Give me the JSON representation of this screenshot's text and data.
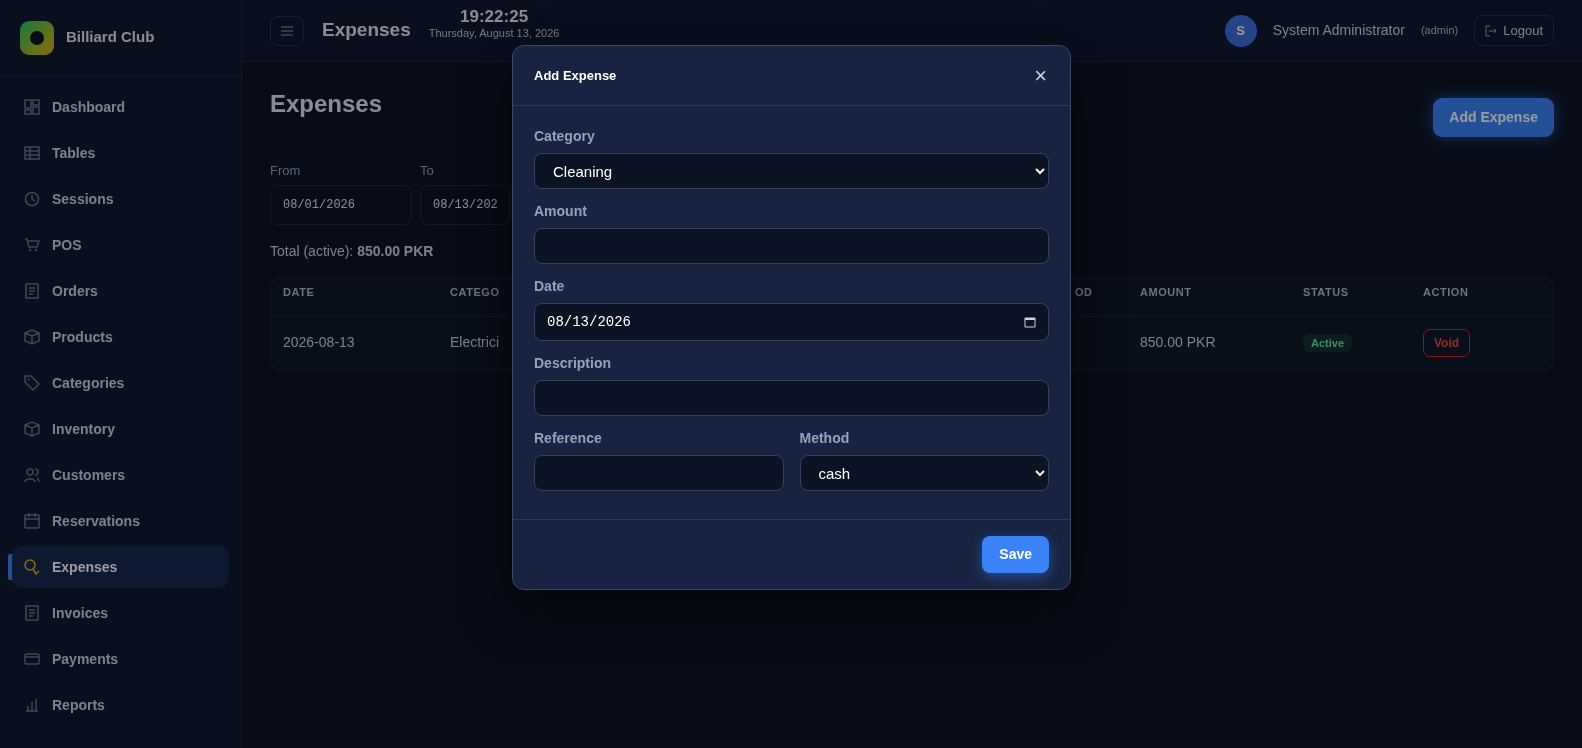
{
  "sidebar": {
    "brand": "Billiard Club",
    "items": [
      {
        "label": "Dashboard",
        "selected": false
      },
      {
        "label": "Tables",
        "selected": false
      },
      {
        "label": "Sessions",
        "selected": false
      },
      {
        "label": "POS",
        "selected": false
      },
      {
        "label": "Orders",
        "selected": false
      },
      {
        "label": "Products",
        "selected": false
      },
      {
        "label": "Categories",
        "selected": false
      },
      {
        "label": "Inventory",
        "selected": false
      },
      {
        "label": "Customers",
        "selected": false
      },
      {
        "label": "Reservations",
        "selected": false
      },
      {
        "label": "Expenses",
        "selected": true
      },
      {
        "label": "Invoices",
        "selected": false
      },
      {
        "label": "Payments",
        "selected": false
      },
      {
        "label": "Reports",
        "selected": false
      }
    ]
  },
  "header": {
    "title": "Expenses",
    "time": "19:22:25",
    "date": "Thursday, August 13, 2026",
    "avatar": "S",
    "user": "System Administrator",
    "role": "(admin)",
    "logout": "Logout"
  },
  "page": {
    "title": "Expenses",
    "add_button": "Add Expense",
    "filters": [
      {
        "label": "From",
        "value": "08/01/2026"
      },
      {
        "label": "To",
        "value": "08/13/202"
      }
    ],
    "total": "Total (active): **850.00 PKR**",
    "table": {
      "columns": [
        "DATE",
        "CATEGO",
        "OD",
        "AMOUNT",
        "STATUS",
        "ACTION"
      ],
      "rows": [
        {
          "cells": [
            "2026-08-13",
            "Electrici",
            "",
            "850.00 PKR"
          ],
          "status": "Active",
          "action": "Void"
        }
      ]
    }
  },
  "modal": {
    "title": "Add Expense",
    "close": "×",
    "fields": [
      {
        "label": "Category",
        "kind": "select",
        "value": "Cleaning"
      },
      {
        "label": "Amount",
        "kind": "text"
      },
      {
        "label": "Date",
        "kind": "date",
        "value": "08/13/2026"
      },
      {
        "label": "Description",
        "kind": "text"
      }
    ],
    "pair": [
      {
        "label": "Reference",
        "kind": "text"
      },
      {
        "label": "Method",
        "kind": "select",
        "value": "cash"
      }
    ],
    "save": "Save"
  }
}
